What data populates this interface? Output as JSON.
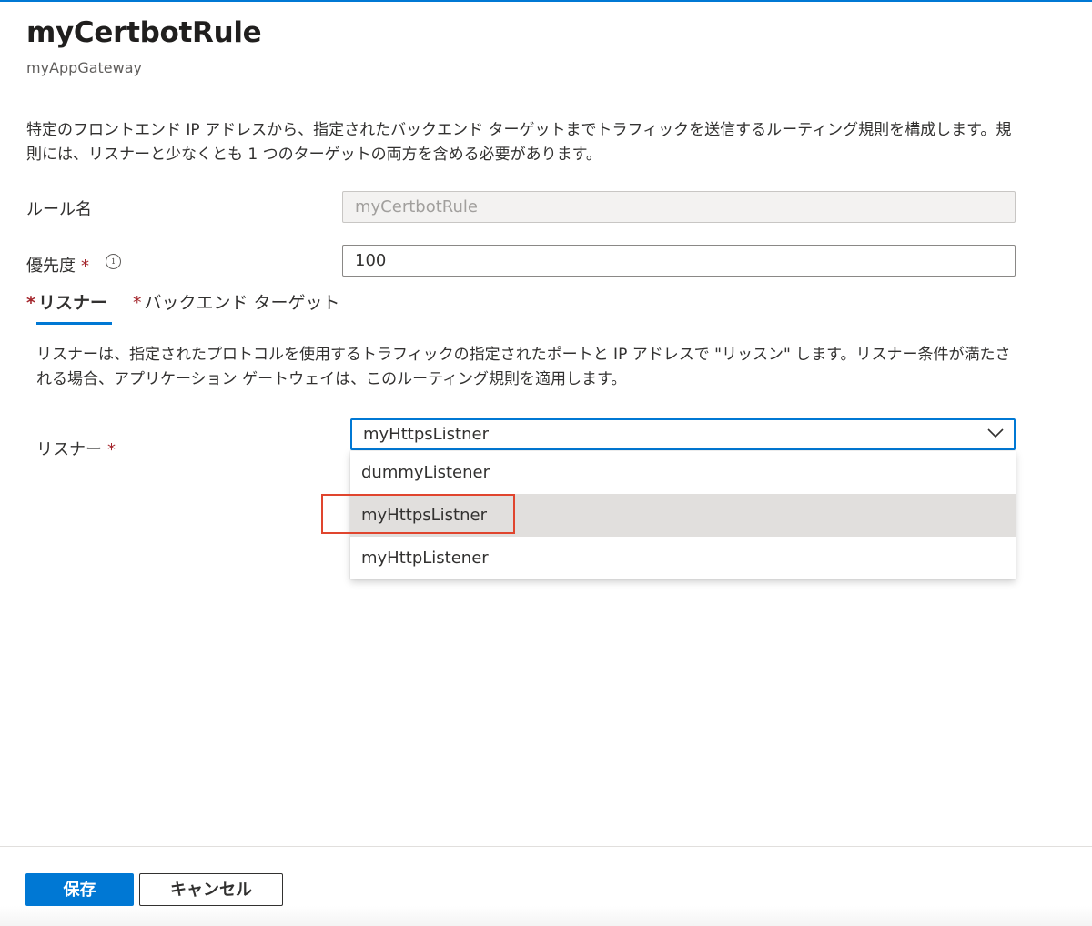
{
  "header": {
    "title": "myCertbotRule",
    "subtitle": "myAppGateway"
  },
  "description": "特定のフロントエンド IP アドレスから、指定されたバックエンド ターゲットまでトラフィックを送信するルーティング規則を構成します。規則には、リスナーと少なくとも 1 つのターゲットの両方を含める必要があります。",
  "fields": {
    "rule_name": {
      "label": "ルール名",
      "value": "myCertbotRule"
    },
    "priority": {
      "label": "優先度",
      "required_mark": "*",
      "info_glyph": "i",
      "value": "100"
    }
  },
  "tabs": [
    {
      "label": "リスナー",
      "required_mark": "*",
      "active": true
    },
    {
      "label": "バックエンド ターゲット",
      "required_mark": "*",
      "active": false
    }
  ],
  "listener_tab": {
    "description": "リスナーは、指定されたプロトコルを使用するトラフィックの指定されたポートと IP アドレスで \"リッスン\" します。リスナー条件が満たされる場合、アプリケーション ゲートウェイは、このルーティング規則を適用します。",
    "listener_label": "リスナー",
    "required_mark": "*",
    "selected_value": "myHttpsListner",
    "options": [
      "dummyListener",
      "myHttpsListner",
      "myHttpListener"
    ],
    "highlighted_option": "myHttpsListner"
  },
  "footer": {
    "save_label": "保存",
    "cancel_label": "キャンセル"
  },
  "colors": {
    "accent": "#0078d4",
    "required": "#a4262c",
    "annotation_highlight": "#e0452e",
    "selected_option_bg": "#e1dfdd"
  },
  "icons": {
    "info": "info-icon",
    "dropdown": "chevron-down-icon"
  }
}
